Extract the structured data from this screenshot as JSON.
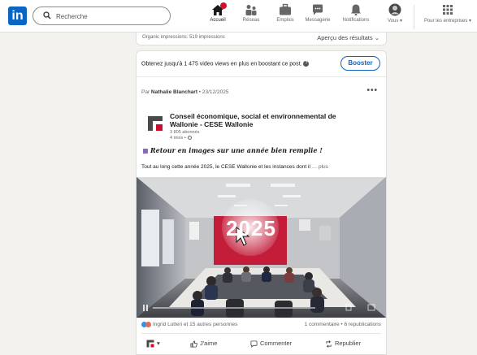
{
  "nav": {
    "logo": "in",
    "search_placeholder": "Recherche",
    "items": [
      {
        "label": "Accueil",
        "icon": "home-icon"
      },
      {
        "label": "Réseau",
        "icon": "network-icon"
      },
      {
        "label": "Emplois",
        "icon": "jobs-icon"
      },
      {
        "label": "Messagerie",
        "icon": "messaging-icon"
      },
      {
        "label": "Notifications",
        "icon": "bell-icon"
      },
      {
        "label": "Vous",
        "icon": "avatar-icon"
      },
      {
        "label": "Pour les entreprises",
        "icon": "grid-icon"
      }
    ]
  },
  "prev_card": {
    "impressions": "Organic impressions: 519 impressions",
    "preview": "Aperçu des résultats"
  },
  "post": {
    "boost_text": "Obtenez jusqu'à 1 475 video views en plus en boostant ce post.",
    "boost_button": "Booster",
    "by_prefix": "Par ",
    "author": "Nathalie Blanchart",
    "date": " • 23/12/2025",
    "company": "Conseil économique, social et environnemental de Wallonie - CESE Wallonie",
    "followers": "3 805 abonnés",
    "age": "4 mois •",
    "headline": "𝑹𝒆𝒕𝒐𝒖𝒓 𝒆𝒏 𝒊𝒎𝒂𝒈𝒆𝒔 𝒔𝒖𝒓 𝒖𝒏𝒆 𝒂𝒏𝒏𝒆́𝒆 𝒃𝒊𝒆𝒏 𝒓𝒆𝒎𝒑𝒍𝒊𝒆 !",
    "body": "Tout au long cette année 2025, le CESE Wallonie et les instances dont il",
    "more": " … plus",
    "image_overlay_text": "2025",
    "reactions_text": "Ingrid Lutteri et 15 autres personnes",
    "stats_text": "1 commentaire • 6 republications",
    "actions": {
      "like": "J'aime",
      "comment": "Commenter",
      "repost": "Republier"
    }
  },
  "colors": {
    "brand": "#0a66c2",
    "notification_badge": "#cb112d",
    "like": "#378fe9",
    "love": "#df704d"
  }
}
